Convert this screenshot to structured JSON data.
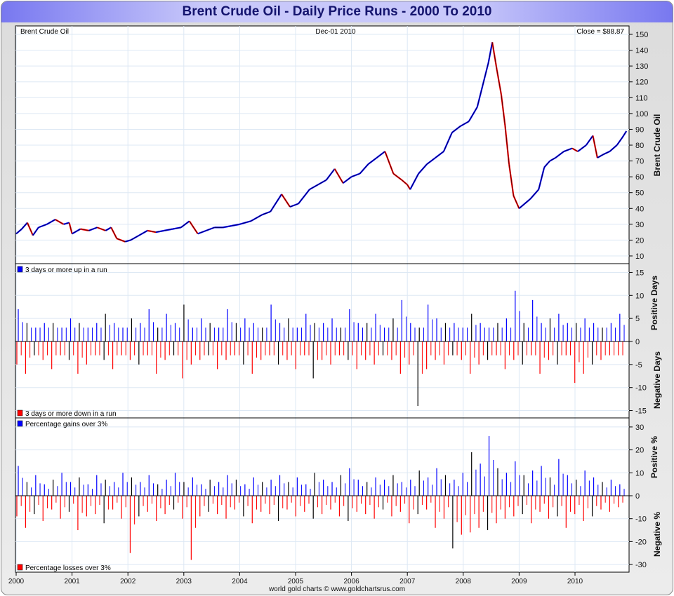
{
  "title": "Brent Crude Oil - Daily Price Runs - 2000 To 2010",
  "footer": "world gold charts © www.goldchartsrus.com",
  "chart_data": [
    {
      "type": "line",
      "header": {
        "left": "Brent Crude Oil",
        "center": "Dec-01  2010",
        "right": "Close = $88.87"
      },
      "ylabel": "Brent Crude Oil",
      "ylim": [
        5,
        155
      ],
      "yticks": [
        10,
        20,
        30,
        40,
        50,
        60,
        70,
        80,
        90,
        100,
        110,
        120,
        130,
        140,
        150
      ],
      "color_up": "#0000ff",
      "color_down": "#ff0000",
      "points": [
        [
          2000.0,
          24
        ],
        [
          2000.1,
          27
        ],
        [
          2000.2,
          31
        ],
        [
          2000.3,
          23
        ],
        [
          2000.4,
          28
        ],
        [
          2000.55,
          30
        ],
        [
          2000.7,
          33
        ],
        [
          2000.85,
          30
        ],
        [
          2000.95,
          31
        ],
        [
          2001.0,
          24
        ],
        [
          2001.15,
          27
        ],
        [
          2001.3,
          26
        ],
        [
          2001.45,
          28
        ],
        [
          2001.6,
          26
        ],
        [
          2001.7,
          28
        ],
        [
          2001.8,
          21
        ],
        [
          2001.95,
          19
        ],
        [
          2002.05,
          20
        ],
        [
          2002.2,
          23
        ],
        [
          2002.35,
          26
        ],
        [
          2002.5,
          25
        ],
        [
          2002.65,
          26
        ],
        [
          2002.8,
          27
        ],
        [
          2002.95,
          28
        ],
        [
          2003.1,
          32
        ],
        [
          2003.25,
          24
        ],
        [
          2003.4,
          26
        ],
        [
          2003.55,
          28
        ],
        [
          2003.7,
          28
        ],
        [
          2003.85,
          29
        ],
        [
          2004.0,
          30
        ],
        [
          2004.2,
          32
        ],
        [
          2004.4,
          36
        ],
        [
          2004.55,
          38
        ],
        [
          2004.75,
          49
        ],
        [
          2004.9,
          41
        ],
        [
          2005.05,
          43
        ],
        [
          2005.25,
          52
        ],
        [
          2005.4,
          55
        ],
        [
          2005.55,
          58
        ],
        [
          2005.7,
          65
        ],
        [
          2005.85,
          56
        ],
        [
          2006.0,
          60
        ],
        [
          2006.15,
          62
        ],
        [
          2006.3,
          68
        ],
        [
          2006.45,
          72
        ],
        [
          2006.6,
          76
        ],
        [
          2006.75,
          62
        ],
        [
          2006.9,
          58
        ],
        [
          2007.0,
          55
        ],
        [
          2007.05,
          52
        ],
        [
          2007.2,
          62
        ],
        [
          2007.35,
          68
        ],
        [
          2007.5,
          72
        ],
        [
          2007.65,
          76
        ],
        [
          2007.8,
          88
        ],
        [
          2007.95,
          92
        ],
        [
          2008.1,
          95
        ],
        [
          2008.25,
          104
        ],
        [
          2008.35,
          118
        ],
        [
          2008.45,
          132
        ],
        [
          2008.52,
          145
        ],
        [
          2008.6,
          128
        ],
        [
          2008.68,
          112
        ],
        [
          2008.75,
          92
        ],
        [
          2008.82,
          68
        ],
        [
          2008.9,
          48
        ],
        [
          2009.0,
          40
        ],
        [
          2009.1,
          43
        ],
        [
          2009.2,
          46
        ],
        [
          2009.35,
          52
        ],
        [
          2009.45,
          66
        ],
        [
          2009.55,
          70
        ],
        [
          2009.65,
          72
        ],
        [
          2009.8,
          76
        ],
        [
          2009.95,
          78
        ],
        [
          2010.05,
          76
        ],
        [
          2010.2,
          80
        ],
        [
          2010.32,
          86
        ],
        [
          2010.4,
          72
        ],
        [
          2010.5,
          74
        ],
        [
          2010.62,
          76
        ],
        [
          2010.75,
          80
        ],
        [
          2010.85,
          85
        ],
        [
          2010.92,
          88.87
        ]
      ]
    },
    {
      "type": "bar",
      "legend": [
        {
          "label": "3 days or more up in a run",
          "color": "#0000ff"
        },
        {
          "label": "3 days or more down in a run",
          "color": "#ff0000"
        }
      ],
      "ylabel_pos": "Positive Days",
      "ylabel_neg": "Negative Days",
      "ylim": [
        -17,
        17
      ],
      "yticks": [
        15,
        10,
        5,
        0,
        -5,
        -10,
        -15
      ],
      "x_range": [
        2000,
        2010.92
      ],
      "positive": [
        7,
        4,
        3,
        4,
        4,
        3,
        5,
        4,
        3,
        4,
        6,
        4,
        3,
        5,
        4,
        7,
        3,
        6,
        4,
        8,
        3,
        5,
        4,
        3,
        7,
        4,
        5,
        4,
        3,
        8,
        4,
        5,
        3,
        6,
        4,
        4,
        5,
        3,
        7,
        4,
        4,
        6,
        3,
        5,
        9,
        4,
        3,
        8,
        5,
        4,
        4,
        3,
        6,
        4,
        3,
        4,
        5,
        11,
        4,
        9,
        4,
        5,
        6,
        4,
        4,
        5,
        4,
        3,
        4,
        6
      ],
      "negative": [
        -5,
        -7,
        -3,
        -4,
        -6,
        -3,
        -4,
        -7,
        -5,
        -3,
        -4,
        -6,
        -3,
        -4,
        -5,
        -3,
        -7,
        -4,
        -3,
        -8,
        -5,
        -4,
        -3,
        -6,
        -4,
        -3,
        -5,
        -7,
        -4,
        -3,
        -5,
        -4,
        -6,
        -3,
        -8,
        -4,
        -5,
        -3,
        -4,
        -6,
        -4,
        -5,
        -3,
        -4,
        -7,
        -5,
        -14,
        -6,
        -4,
        -5,
        -3,
        -4,
        -7,
        -5,
        -4,
        -3,
        -6,
        -4,
        -5,
        -3,
        -7,
        -4,
        -5,
        -3,
        -9,
        -7,
        -5,
        -4,
        -3,
        -3
      ]
    },
    {
      "type": "bar",
      "legend": [
        {
          "label": "Percentage gains over 3%",
          "color": "#0000ff"
        },
        {
          "label": "Percentage losses over 3%",
          "color": "#ff0000"
        }
      ],
      "ylabel_pos": "Positive %",
      "ylabel_neg": "Negative %",
      "ylim": [
        -33,
        33
      ],
      "yticks": [
        30,
        20,
        10,
        0,
        -10,
        -20,
        -30
      ],
      "x_range": [
        2000,
        2010.92
      ],
      "positive": [
        13,
        6,
        9,
        5,
        7,
        10,
        6,
        8,
        5,
        9,
        7,
        6,
        10,
        8,
        6,
        9,
        5,
        7,
        10,
        6,
        8,
        5,
        7,
        6,
        9,
        7,
        5,
        8,
        6,
        7,
        9,
        6,
        8,
        5,
        10,
        7,
        6,
        9,
        12,
        7,
        6,
        8,
        7,
        9,
        6,
        7,
        11,
        8,
        12,
        9,
        7,
        10,
        19,
        14,
        26,
        12,
        10,
        15,
        9,
        11,
        13,
        8,
        16,
        9,
        7,
        11,
        8,
        6,
        7,
        5
      ],
      "negative": [
        -9,
        -14,
        -8,
        -11,
        -6,
        -10,
        -7,
        -15,
        -9,
        -8,
        -12,
        -6,
        -10,
        -25,
        -9,
        -7,
        -11,
        -8,
        -6,
        -10,
        -28,
        -9,
        -7,
        -8,
        -10,
        -6,
        -9,
        -12,
        -7,
        -8,
        -11,
        -6,
        -9,
        -7,
        -10,
        -8,
        -6,
        -9,
        -11,
        -7,
        -8,
        -10,
        -6,
        -9,
        -7,
        -12,
        -8,
        -6,
        -14,
        -10,
        -23,
        -17,
        -16,
        -14,
        -15,
        -12,
        -10,
        -9,
        -8,
        -12,
        -7,
        -10,
        -9,
        -14,
        -8,
        -11,
        -9,
        -6,
        -7,
        -5
      ]
    }
  ],
  "x_ticks": [
    "2000",
    "2001",
    "2002",
    "2003",
    "2004",
    "2005",
    "2006",
    "2007",
    "2008",
    "2009",
    "2010"
  ]
}
